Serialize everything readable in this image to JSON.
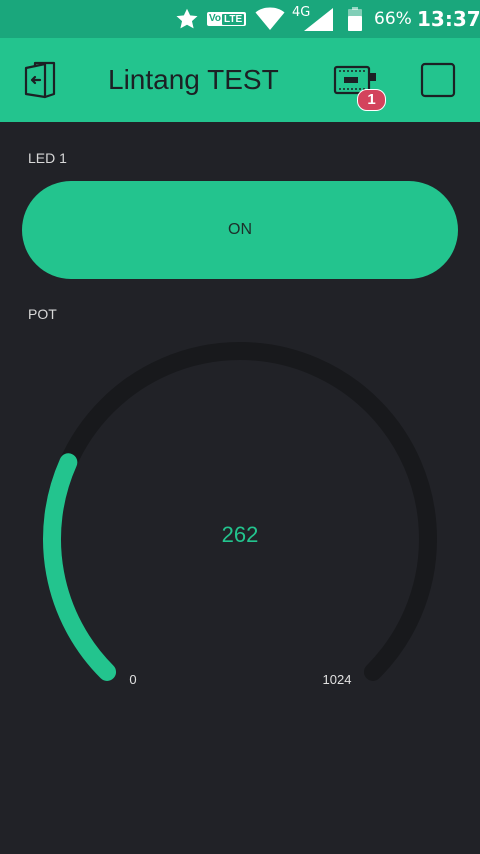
{
  "status_bar": {
    "volte_vo": "Vo",
    "volte_lte": "LTE",
    "network": "4G",
    "battery": "66%",
    "time": "13:37",
    "icons": [
      "star-icon",
      "volte-icon",
      "wifi-icon",
      "signal-icon",
      "battery-icon"
    ]
  },
  "app_bar": {
    "title": "Lintang TEST",
    "device_badge": "1",
    "icons": [
      "exit-icon",
      "device-board-icon",
      "square-icon"
    ]
  },
  "widgets": {
    "led": {
      "label": "LED 1",
      "state": "ON"
    },
    "pot": {
      "label": "POT",
      "value": 262,
      "value_text": "262",
      "min": 0,
      "max": 1024,
      "min_text": "0",
      "max_text": "1024"
    }
  },
  "colors": {
    "accent": "#23c48e",
    "status_bar": "#1aa77c",
    "background": "#212227",
    "gauge_track": "#18191c",
    "badge": "#d3435c"
  }
}
